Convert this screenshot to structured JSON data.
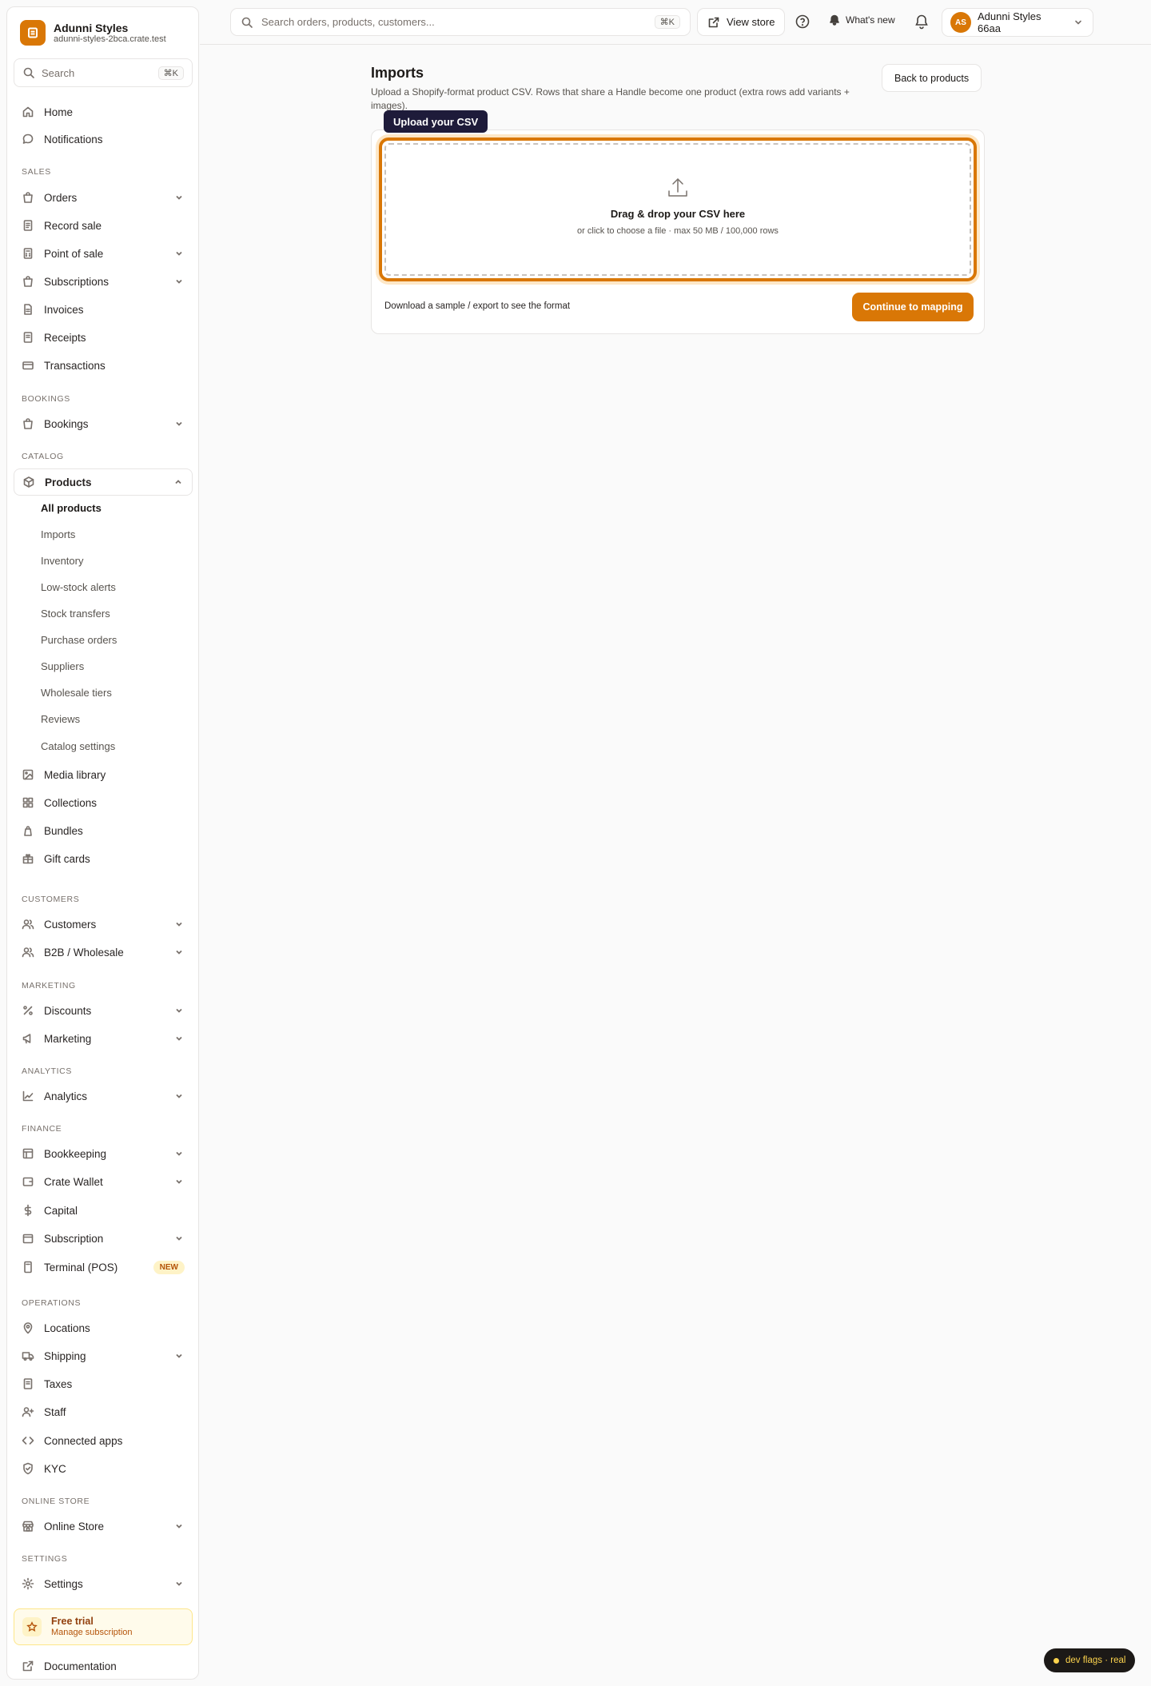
{
  "brand": {
    "name": "Adunni Styles",
    "url": "adunni-styles-2bca.crate.test"
  },
  "sidebar_search": {
    "placeholder": "Search",
    "shortcut": "⌘K"
  },
  "nav": {
    "home": "Home",
    "notifications": "Notifications",
    "sales_section": "SALES",
    "orders": "Orders",
    "record_sale": "Record sale",
    "point_of_sale": "Point of sale",
    "subscriptions": "Subscriptions",
    "invoices": "Invoices",
    "receipts": "Receipts",
    "transactions": "Transactions",
    "bookings_section": "BOOKINGS",
    "bookings": "Bookings",
    "catalog_section": "CATALOG",
    "products": "Products",
    "products_sub": [
      "All products",
      "Imports",
      "Inventory",
      "Low-stock alerts",
      "Stock transfers",
      "Purchase orders",
      "Suppliers",
      "Wholesale tiers",
      "Reviews",
      "Catalog settings"
    ],
    "media_library": "Media library",
    "collections": "Collections",
    "bundles": "Bundles",
    "gift_cards": "Gift cards",
    "customers_section": "CUSTOMERS",
    "customers": "Customers",
    "b2b": "B2B / Wholesale",
    "marketing_section": "MARKETING",
    "discounts": "Discounts",
    "marketing": "Marketing",
    "analytics_section": "ANALYTICS",
    "analytics": "Analytics",
    "finance_section": "FINANCE",
    "bookkeeping": "Bookkeeping",
    "crate_wallet": "Crate Wallet",
    "capital": "Capital",
    "subscription": "Subscription",
    "terminal": "Terminal (POS)",
    "terminal_badge": "NEW",
    "operations_section": "OPERATIONS",
    "locations": "Locations",
    "shipping": "Shipping",
    "taxes": "Taxes",
    "staff": "Staff",
    "connected_apps": "Connected apps",
    "kyc": "KYC",
    "online_store_section": "ONLINE STORE",
    "online_store": "Online Store",
    "settings_section": "SETTINGS",
    "settings": "Settings"
  },
  "trial": {
    "title": "Free trial",
    "subtitle": "Manage subscription"
  },
  "documentation": "Documentation",
  "topbar": {
    "search_placeholder": "Search orders, products, customers...",
    "search_shortcut": "⌘K",
    "view_store": "View store",
    "whats_new": "What's new",
    "account_initials": "AS",
    "account_name": "Adunni Styles 66aa"
  },
  "page": {
    "title": "Imports",
    "description": "Upload a Shopify-format product CSV. Rows that share a Handle become one product (extra rows add variants + images).",
    "back_button": "Back to products",
    "tooltip": "Upload your CSV",
    "dropzone_title": "Drag & drop your CSV here",
    "dropzone_sub": "or click to choose a file · max 50 MB / 100,000 rows",
    "sample_text": "Download a sample / export to see the format",
    "continue_button": "Continue to mapping"
  },
  "dev_flags": "dev flags · real",
  "colors": {
    "accent": "#d97706",
    "tooltip_bg": "#1e1b3a"
  }
}
